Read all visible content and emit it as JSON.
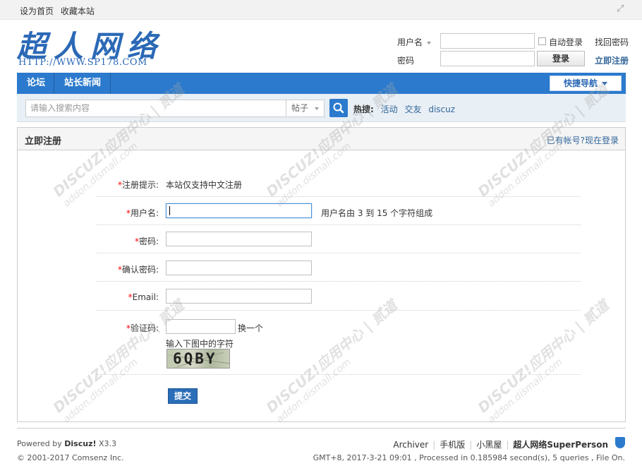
{
  "topbar": {
    "set_home": "设为首页",
    "bookmark": "收藏本站"
  },
  "header": {
    "logo_text": "超人网络",
    "logo_url": "HTTP://WWW.SP178.COM"
  },
  "login": {
    "username_label": "用户名",
    "password_label": "密码",
    "auto_login": "自动登录",
    "login_button": "登录",
    "find_password": "找回密码",
    "register_now": "立即注册"
  },
  "nav": {
    "items": [
      "论坛",
      "站长新闻"
    ],
    "quick_nav": "快捷导航"
  },
  "search": {
    "placeholder": "请输入搜索内容",
    "type": "帖子",
    "hot_label": "热搜:",
    "hot_items": [
      "活动",
      "交友",
      "discuz"
    ]
  },
  "panel": {
    "title": "立即注册",
    "have_account": "已有帐号?现在登录"
  },
  "form": {
    "notice_label": "注册提示:",
    "notice_text": "本站仅支持中文注册",
    "username_label": "用户名:",
    "username_value": "",
    "username_hint": "用户名由 3 到 15 个字符组成",
    "password_label": "密码:",
    "confirm_label": "确认密码:",
    "email_label": "Email:",
    "captcha_label": "验证码:",
    "captcha_refresh": "换一个",
    "captcha_hint": "输入下图中的字符",
    "captcha_text": "6QBY",
    "submit": "提交"
  },
  "footer": {
    "powered_prefix": "Powered by",
    "powered_brand": "Discuz!",
    "version": "X3.3",
    "copyright": "© 2001-2017 Comsenz Inc.",
    "links": [
      "Archiver",
      "手机版",
      "小黑屋"
    ],
    "site_name": "超人网络SuperPerson",
    "stats": "GMT+8, 2017-3-21 09:01 , Processed in 0.185984 second(s), 5 queries , File On."
  },
  "watermark": {
    "line1": "DISCUZ!应用中心 | 贰道",
    "line2": "addon.dismall.com"
  }
}
